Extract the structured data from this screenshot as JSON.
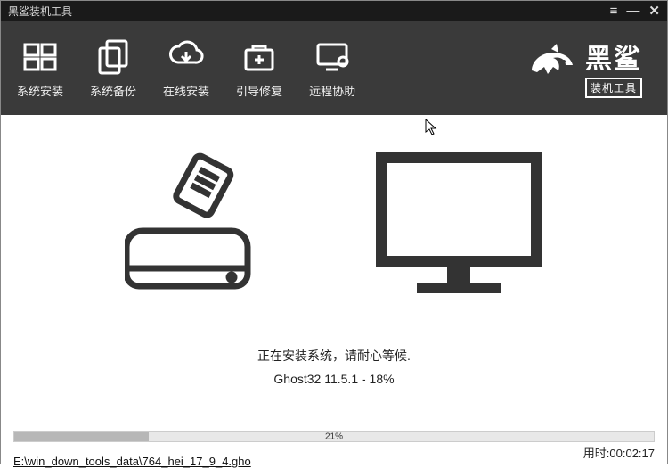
{
  "titlebar": {
    "title": "黑鲨装机工具"
  },
  "nav": {
    "install": "系统安装",
    "backup": "系统备份",
    "online": "在线安装",
    "bootfix": "引导修复",
    "remote": "远程协助"
  },
  "brand": {
    "main": "黑鲨",
    "sub": "装机工具"
  },
  "status": {
    "line1": "正在安装系统，请耐心等候.",
    "line2": "Ghost32 11.5.1 - 18%"
  },
  "progress": {
    "percent": 21,
    "label": "21%",
    "elapsed_label": "用时:00:02:17",
    "filepath": "E:\\win_down_tools_data\\764_hei_17_9_4.gho"
  },
  "colors": {
    "header": "#3a3a3a",
    "titlebar": "#1a1a1a",
    "progress_fill": "#b7b7b7"
  }
}
